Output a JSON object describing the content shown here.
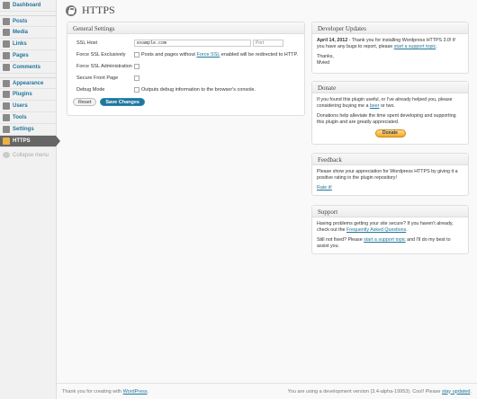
{
  "sidebar": {
    "items": [
      {
        "label": "Dashboard"
      },
      {
        "label": "Posts"
      },
      {
        "label": "Media"
      },
      {
        "label": "Links"
      },
      {
        "label": "Pages"
      },
      {
        "label": "Comments"
      },
      {
        "label": "Appearance"
      },
      {
        "label": "Plugins"
      },
      {
        "label": "Users"
      },
      {
        "label": "Tools"
      },
      {
        "label": "Settings"
      },
      {
        "label": "HTTPS"
      },
      {
        "label": "Collapse menu"
      }
    ]
  },
  "header": {
    "title": "HTTPS"
  },
  "settings": {
    "title": "General Settings",
    "ssl_host_label": "SSL Host",
    "ssl_host_value": "example.com",
    "port_placeholder": "Port",
    "force_ssl_label": "Force SSL Exclusively",
    "force_ssl_desc_pre": "Posts and pages without ",
    "force_ssl_link": "Force SSL",
    "force_ssl_desc_post": " enabled will be redirected to HTTP.",
    "force_admin_label": "Force SSL Administration",
    "secure_front_label": "Secure Front Page",
    "debug_label": "Debug Mode",
    "debug_desc": "Outputs debug information to the browser's console.",
    "reset_label": "Reset",
    "save_label": "Save Changes"
  },
  "dev_updates": {
    "title": "Developer Updates",
    "date": "April 14, 2012",
    "text_1": " - Thank you for installing Wordpress HTTPS 3.0! If you have any bugs to report, please ",
    "link": "start a support topic",
    "text_2": ".",
    "thanks": "Thanks,",
    "name": "Mvied"
  },
  "donate": {
    "title": "Donate",
    "p1_pre": "If you found this plugin useful, or I've already helped you, please considering buying me a ",
    "p1_link": "beer",
    "p1_post": " or two.",
    "p2": "Donations help alleviate the time spent developing and supporting this plugin and are greatly appreciated.",
    "button": "Donate"
  },
  "feedback": {
    "title": "Feedback",
    "text": "Please show your appreciation for Wordpress HTTPS by giving it a positive rating in the plugin repository!",
    "link": "Rate it!"
  },
  "support": {
    "title": "Support",
    "p1_pre": "Having problems getting your site secure? If you haven't already, check out the ",
    "p1_link": "Frequently Asked Questions",
    "p1_post": ".",
    "p2_pre": "Still not fixed? Please ",
    "p2_link": "start a support topic",
    "p2_post": " and I'll do my best to assist you."
  },
  "footer": {
    "left_pre": "Thank you for creating with ",
    "left_link": "WordPress",
    "left_post": ".",
    "right_pre": "You are using a development version (3.4-alpha-19953). Cool! Please ",
    "right_link": "stay updated",
    "right_post": "."
  }
}
